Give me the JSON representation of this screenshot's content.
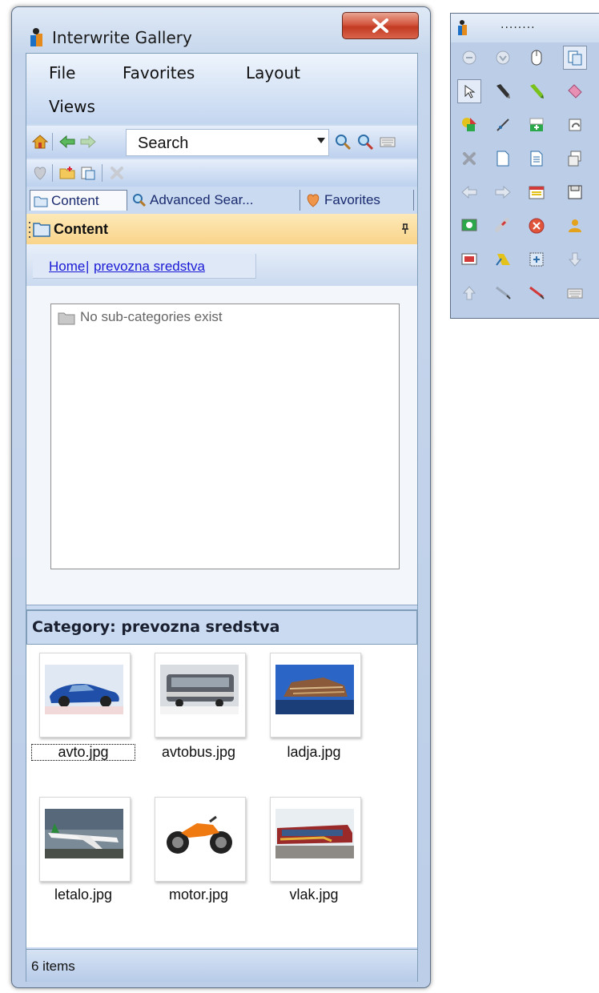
{
  "window": {
    "title": "Interwrite Gallery"
  },
  "menu": {
    "file": "File",
    "favorites": "Favorites",
    "layout": "Layout",
    "views": "Views"
  },
  "search": {
    "value": "Search"
  },
  "tabs": [
    {
      "label": "Content",
      "icon": "folder-icon"
    },
    {
      "label": "Advanced Sear...",
      "icon": "magnifier-icon"
    },
    {
      "label": "Favorites",
      "icon": "heart-icon"
    }
  ],
  "content_panel": {
    "title": "Content",
    "pin": "ᵖ"
  },
  "breadcrumb": {
    "home": "Home",
    "separator": "|",
    "current": "prevozna sredstva"
  },
  "subcategories": {
    "message": "No sub-categories exist"
  },
  "category": {
    "header": "Category: prevozna sredstva"
  },
  "items": [
    {
      "name": "avto.jpg",
      "icon": "car-thumbnail"
    },
    {
      "name": "avtobus.jpg",
      "icon": "bus-thumbnail"
    },
    {
      "name": "ladja.jpg",
      "icon": "ship-thumbnail"
    },
    {
      "name": "letalo.jpg",
      "icon": "airplane-thumbnail"
    },
    {
      "name": "motor.jpg",
      "icon": "motorcycle-thumbnail"
    },
    {
      "name": "vlak.jpg",
      "icon": "train-thumbnail"
    }
  ],
  "status": {
    "text": "6 items"
  },
  "palette": {
    "title": "........"
  },
  "colors": {
    "accent": "#c9daf1",
    "content_header": "#f9d48a",
    "close_button": "#c33a22",
    "link": "#1a1ad6"
  }
}
